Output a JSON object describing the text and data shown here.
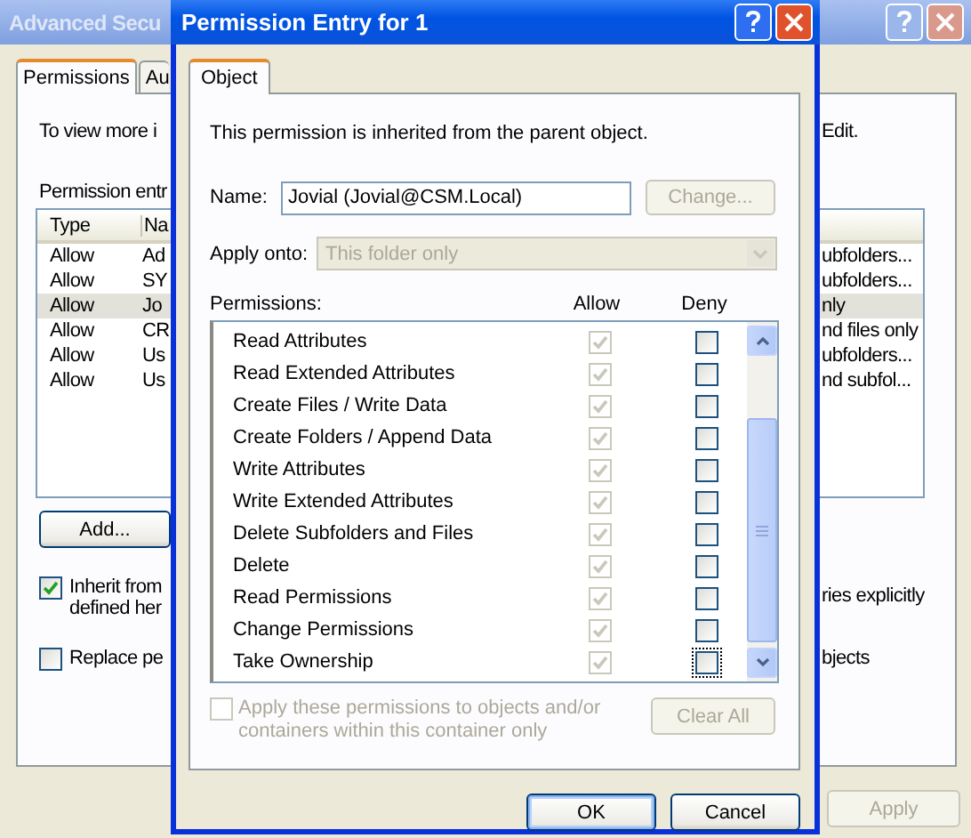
{
  "back_window": {
    "title": "Advanced Secu",
    "tabs": [
      {
        "label": "Permissions",
        "selected": true
      },
      {
        "label": "Au",
        "selected": false
      }
    ],
    "intro_left": "To view more i",
    "intro_right": "Edit.",
    "entries_label": "Permission entr",
    "columns": [
      "Type",
      "Na"
    ],
    "rows": [
      {
        "type": "Allow",
        "name": "Ad",
        "apply_to": "ubfolders...",
        "selected": false
      },
      {
        "type": "Allow",
        "name": "SY",
        "apply_to": "ubfolders...",
        "selected": false
      },
      {
        "type": "Allow",
        "name": "Jo",
        "apply_to": "nly",
        "selected": true
      },
      {
        "type": "Allow",
        "name": "CR",
        "apply_to": "nd files only",
        "selected": false
      },
      {
        "type": "Allow",
        "name": "Us",
        "apply_to": "ubfolders...",
        "selected": false
      },
      {
        "type": "Allow",
        "name": "Us",
        "apply_to": "nd subfol...",
        "selected": false
      }
    ],
    "add_button": "Add...",
    "inherit": {
      "checked": true,
      "lines": [
        "Inherit from",
        "defined her"
      ],
      "tail": "ries explicitly"
    },
    "replace": {
      "checked": false,
      "label": "Replace pe",
      "tail": "bjects"
    },
    "apply_button": {
      "label": "Apply",
      "disabled": true
    }
  },
  "dialog": {
    "title": "Permission Entry for 1",
    "tabs": [
      {
        "label": "Object",
        "selected": true
      }
    ],
    "intro": "This permission is inherited from the parent object.",
    "name_label": "Name:",
    "name_value": "Jovial (Jovial@CSM.Local)",
    "change_button": {
      "label": "Change...",
      "disabled": true
    },
    "apply_onto": {
      "label": "Apply onto:",
      "value": "This folder only",
      "disabled": true
    },
    "permissions": {
      "label": "Permissions:",
      "allow_heading": "Allow",
      "deny_heading": "Deny",
      "items": [
        {
          "label": "Read Attributes",
          "allow": true,
          "allow_disabled": true,
          "deny": false,
          "focused": false
        },
        {
          "label": "Read Extended Attributes",
          "allow": true,
          "allow_disabled": true,
          "deny": false,
          "focused": false
        },
        {
          "label": "Create Files / Write Data",
          "allow": true,
          "allow_disabled": true,
          "deny": false,
          "focused": false
        },
        {
          "label": "Create Folders / Append Data",
          "allow": true,
          "allow_disabled": true,
          "deny": false,
          "focused": false
        },
        {
          "label": "Write Attributes",
          "allow": true,
          "allow_disabled": true,
          "deny": false,
          "focused": false
        },
        {
          "label": "Write Extended Attributes",
          "allow": true,
          "allow_disabled": true,
          "deny": false,
          "focused": false
        },
        {
          "label": "Delete Subfolders and Files",
          "allow": true,
          "allow_disabled": true,
          "deny": false,
          "focused": false
        },
        {
          "label": "Delete",
          "allow": true,
          "allow_disabled": true,
          "deny": false,
          "focused": false
        },
        {
          "label": "Read Permissions",
          "allow": true,
          "allow_disabled": true,
          "deny": false,
          "focused": false
        },
        {
          "label": "Change Permissions",
          "allow": true,
          "allow_disabled": true,
          "deny": false,
          "focused": false
        },
        {
          "label": "Take Ownership",
          "allow": true,
          "allow_disabled": true,
          "deny": false,
          "focused": true
        }
      ]
    },
    "apply_children": {
      "label": "Apply these permissions to objects and/or containers within this container only",
      "checked": false,
      "disabled": true
    },
    "clear_all": {
      "label": "Clear All",
      "disabled": true
    },
    "buttons": [
      {
        "label": "OK",
        "default": true
      },
      {
        "label": "Cancel",
        "default": false
      }
    ]
  }
}
